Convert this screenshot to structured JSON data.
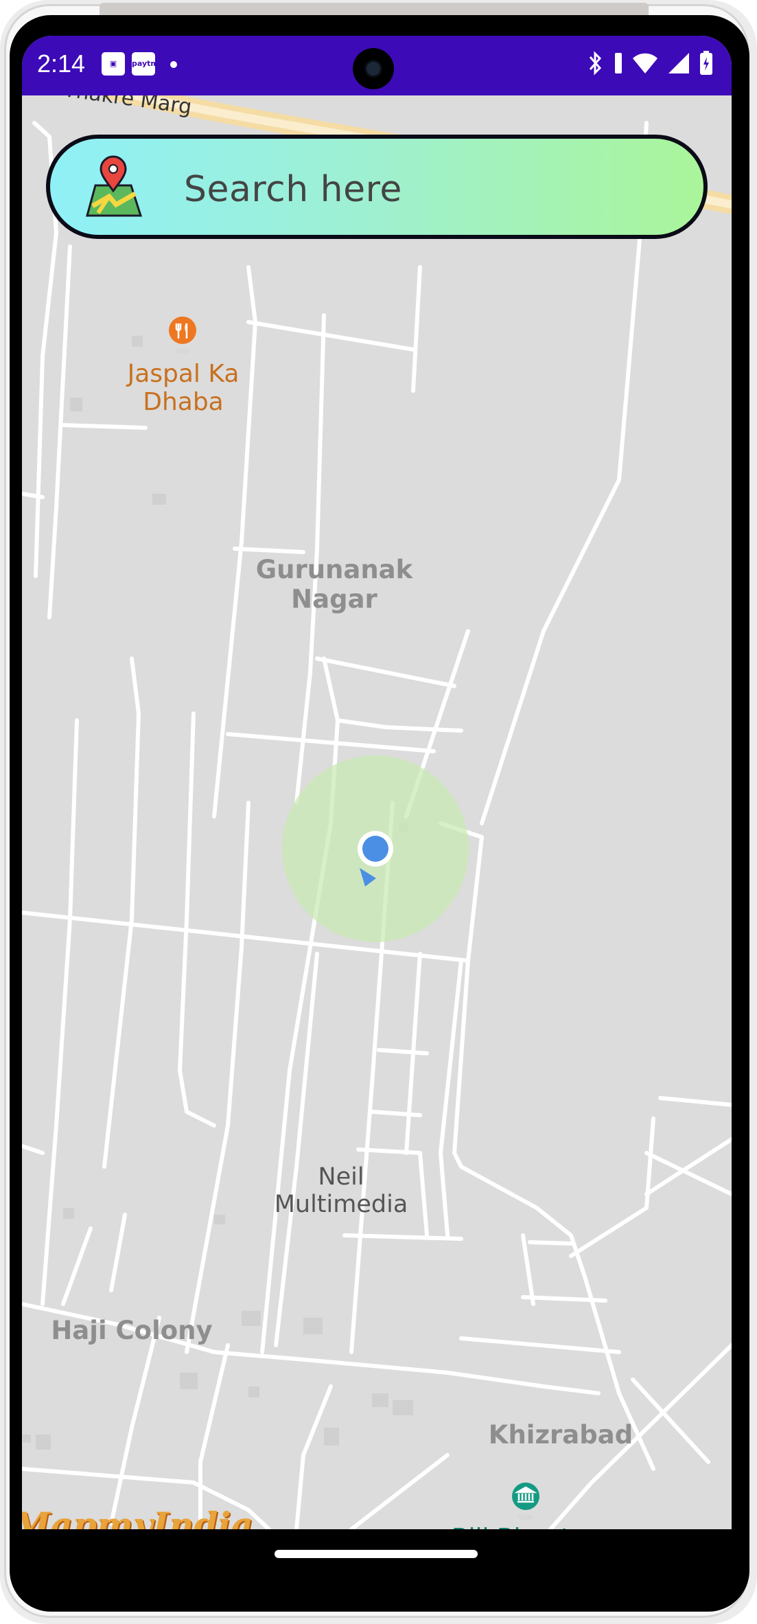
{
  "status_bar": {
    "time": "2:14",
    "paytm_label": "paytm",
    "background_color": "#3d0ab8"
  },
  "search": {
    "placeholder": "Search here",
    "icon": "map-pin-icon"
  },
  "map": {
    "road_label": "Thakre Marg",
    "places": {
      "restaurant": "Jaspal Ka\nDhaba",
      "gurunanak": "Gurunanak\nNagar",
      "neil": "Neil\nMultimedia",
      "haji": "Haji Colony",
      "khizrabad": "Khizrabad",
      "bill": "Bill Bhugtan"
    },
    "watermark": "MapmyIndia"
  }
}
